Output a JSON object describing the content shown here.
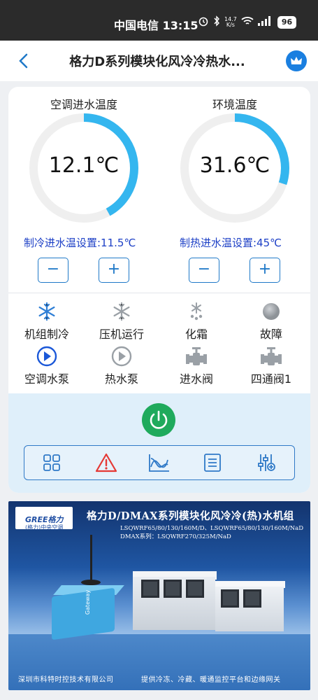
{
  "status_bar": {
    "carrier_time": "中国电信 13:15",
    "net_speed": "14.7\nK/s",
    "battery": "96"
  },
  "nav": {
    "title": "格力D系列模块化风冷冷热水..."
  },
  "gauges": [
    {
      "label": "空调进水温度",
      "value": "12.1℃",
      "fraction": 0.42,
      "setpoint": "制冷进水温设置:11.5℃"
    },
    {
      "label": "环境温度",
      "value": "31.6℃",
      "fraction": 0.3,
      "setpoint": "制热进水温设置:45℃"
    }
  ],
  "stepper": {
    "minus": "−",
    "plus": "+"
  },
  "status_items": [
    {
      "label": "机组制冷",
      "icon": "snowflake-icon",
      "color": "#2f7fd6"
    },
    {
      "label": "压机运行",
      "icon": "snowflake-icon",
      "color": "#9aa0a6"
    },
    {
      "label": "化霜",
      "icon": "defrost-icon",
      "color": "#9aa0a6"
    },
    {
      "label": "故障",
      "icon": "fault-dot-icon",
      "color": "#9aa0a6"
    },
    {
      "label": "空调水泵",
      "icon": "pump-icon",
      "color": "#1b58d8"
    },
    {
      "label": "热水泵",
      "icon": "pump-icon",
      "color": "#9aa0a6"
    },
    {
      "label": "进水阀",
      "icon": "valve-icon",
      "color": "#9aa0a6"
    },
    {
      "label": "四通阀1",
      "icon": "valve-icon",
      "color": "#9aa0a6"
    }
  ],
  "toolbar": {
    "items": [
      "grid-icon",
      "alarm-icon",
      "curve-chart-icon",
      "list-icon",
      "settings-sliders-icon"
    ]
  },
  "banner": {
    "logo_text": "GREE格力",
    "logo_sub": "(格力)中央空调",
    "title": "格力D/DMAX系列模块化风冷冷(热)水机组",
    "line1": "LSQWRF65/80/130/160M/D、LSQWRF65/80/130/160M/NaD",
    "line2": "DMAX系列：LSQWRF270/325M/NaD",
    "footer_left": "深圳市科特时控技术有限公司",
    "footer_right": "提供冷冻、冷藏、暖通监控平台和边缘网关",
    "device_label": "Gateway"
  },
  "colors": {
    "accent": "#1f79c8",
    "gauge_arc": "#34b6ef",
    "setpoint_text": "#1c3fc6",
    "power_button": "#1faa5c",
    "alarm": "#e53935"
  }
}
